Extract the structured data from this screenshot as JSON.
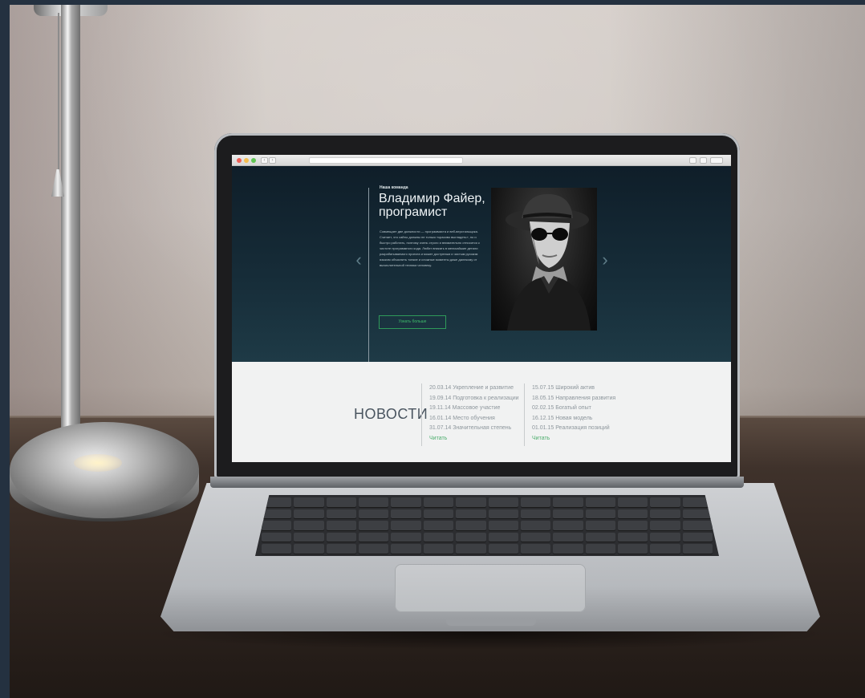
{
  "browser": {
    "back_glyph": "‹",
    "forward_glyph": "›",
    "traffic_light_colors": [
      "#ee5f56",
      "#f4bd4f",
      "#60c554"
    ]
  },
  "hero": {
    "kicker": "Наша команда",
    "title": "Владимир Файер, програмист",
    "description": "Совмещает две должности — программиста и веб-верстальщика. Считает, что сайты должны не только «красиво выглядеть», но и быстро работать, поэтому очень строго и внимательно относится к чистоте программного кода. Любит вникать в мельчайшие детали разрабатываемого проекта и может доступным и чистым русским языком объяснить тонкие и сложные моменты даже далекому от вычислительной техники человеку.",
    "button_label": "Узнать больше",
    "prev_arrow": "‹",
    "next_arrow": "›",
    "accent_color": "#3fbf6c"
  },
  "news": {
    "title": "НОВОСТИ",
    "columns": [
      {
        "items": [
          "20.03.14 Укрепление и развитие",
          "19.09.14 Подготовка к реализации",
          "19.11.14 Массовое участие",
          "16.01.14 Место обучения",
          "31.07.14 Значительная степень"
        ],
        "more_label": "Читать"
      },
      {
        "items": [
          "15.07.15 Широкий актив",
          "18.05.15 Направления развития",
          "02.02.15 Богатый опыт",
          "16.12.15 Новая модель",
          "01.01.15 Реализация позиций"
        ],
        "more_label": "Читать"
      }
    ]
  }
}
